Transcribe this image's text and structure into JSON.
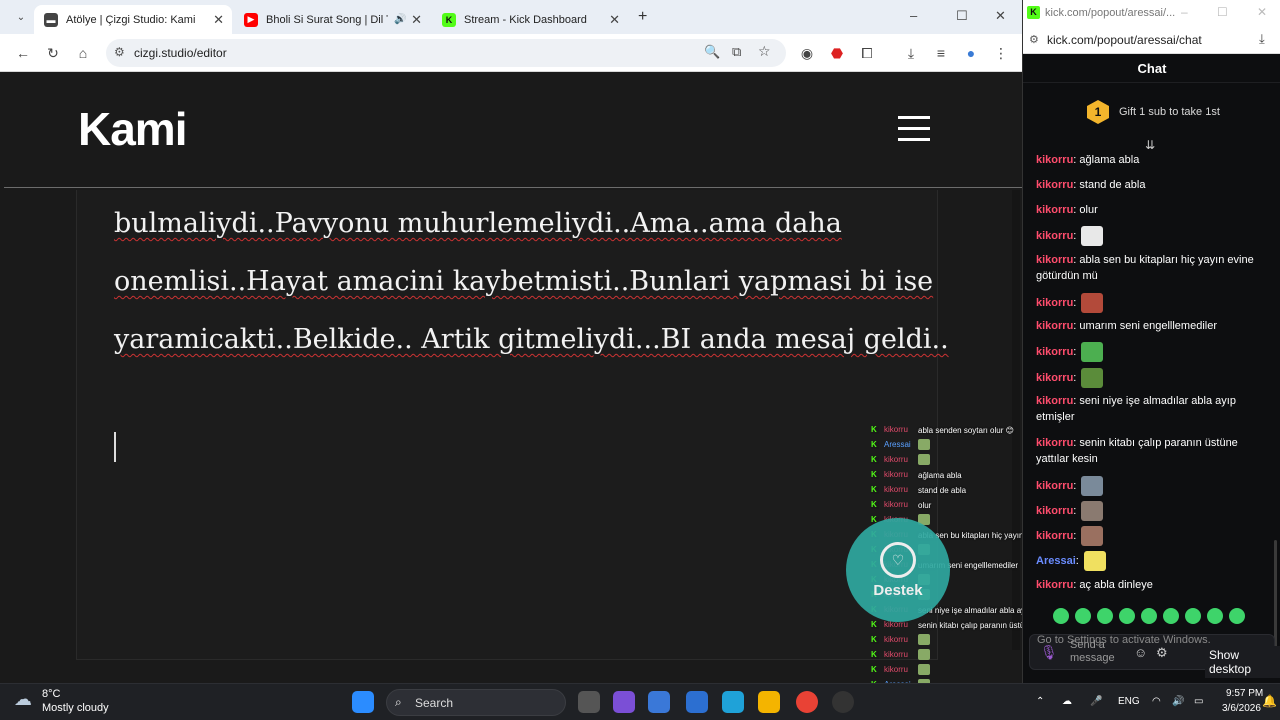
{
  "browser_left": {
    "tabs": [
      {
        "label": "Atölye | Çizgi Studio: Kami",
        "favicon": "cizgi-favicon",
        "active": true
      },
      {
        "label": "Bholi Si Surat Song | Dil To Pa",
        "favicon": "youtube-icon",
        "active": false
      },
      {
        "label": "Stream - Kick Dashboard",
        "favicon": "kick-icon",
        "active": false
      }
    ],
    "url": "cizgi.studio/editor",
    "new_tab": "+",
    "window_controls": {
      "minimize": "–",
      "maximize": "☐",
      "close": "✕"
    }
  },
  "site": {
    "brand": "Kami",
    "story_lines": [
      "bulmaliydi..Pavyonu muhurlemeliydi..Ama..ama daha",
      "onemlisi..Hayat amacini kaybetmisti..Bunlari yapmasi bi ise",
      "yaramicakti..Belkide.. Artik gitmeliydi...BI anda mesaj geldi.."
    ],
    "cursor_char": "'"
  },
  "overlay_chat": {
    "messages": [
      {
        "user": "kikorru",
        "text": "abla senden soytarı olur 😊"
      },
      {
        "user": "Aressai",
        "text": "",
        "emote": true,
        "blue": true
      },
      {
        "user": "kikorru",
        "text": "",
        "emote": true
      },
      {
        "user": "kikorru",
        "text": "ağlama abla"
      },
      {
        "user": "kikorru",
        "text": "stand de abla"
      },
      {
        "user": "kikorru",
        "text": "olur"
      },
      {
        "user": "kikorru",
        "text": "",
        "emote": true
      },
      {
        "user": "kikorru",
        "text": "abla sen bu kitapları hiç yayın evine götürdün mü"
      },
      {
        "user": "kikorru",
        "text": "",
        "emote": true
      },
      {
        "user": "kikorru",
        "text": "umarım seni engelllemediler"
      },
      {
        "user": "kikorru",
        "text": "",
        "emote": true
      },
      {
        "user": "kikorru",
        "text": "",
        "emote": true
      },
      {
        "user": "kikorru",
        "text": "seni niye işe almadılar abla ayıp etmişler"
      },
      {
        "user": "kikorru",
        "text": "senin kitabı çalıp paranın üstüne yattılar kesin"
      },
      {
        "user": "kikorru",
        "text": "",
        "emote": true
      },
      {
        "user": "kikorru",
        "text": "",
        "emote": true
      },
      {
        "user": "kikorru",
        "text": "",
        "emote": true
      },
      {
        "user": "Aressai",
        "text": "",
        "emote": true,
        "blue": true
      },
      {
        "user": "kikorru",
        "text": "aç abla dinleye"
      }
    ],
    "destek_label": "Destek"
  },
  "browser_right": {
    "title": "kick.com/popout/aressai/...",
    "url": "kick.com/popout/aressai/chat",
    "chat_title": "Chat",
    "gift_badge": "1",
    "gift_text": "Gift 1 sub to take 1st",
    "messages": [
      {
        "user": "kikorru",
        "text": "ağlama abla"
      },
      {
        "user": "kikorru",
        "text": "stand de abla"
      },
      {
        "user": "kikorru",
        "text": "olur"
      },
      {
        "user": "kikorru",
        "text": "",
        "emote_color": "#e8e8e8"
      },
      {
        "user": "kikorru",
        "text": "abla sen bu kitapları hiç yayın evine götürdün mü"
      },
      {
        "user": "kikorru",
        "text": "",
        "emote_color": "#b34a3a"
      },
      {
        "user": "kikorru",
        "text": "umarım seni engelllemediler"
      },
      {
        "user": "kikorru",
        "text": "",
        "emote_color": "#4caf50"
      },
      {
        "user": "kikorru",
        "text": "",
        "emote_color": "#5b8c3a"
      },
      {
        "user": "kikorru",
        "text": "seni niye işe almadılar abla ayıp etmişler"
      },
      {
        "user": "kikorru",
        "text": "senin kitabı çalıp paranın üstüne yattılar kesin"
      },
      {
        "user": "kikorru",
        "text": "",
        "emote_color": "#7a8a9a"
      },
      {
        "user": "kikorru",
        "text": "",
        "emote_color": "#8a7a70"
      },
      {
        "user": "kikorru",
        "text": "",
        "emote_color": "#9a7060"
      },
      {
        "user": "Aressai",
        "text": "",
        "emote_color": "#f0e060",
        "blue": true
      },
      {
        "user": "kikorru",
        "text": "aç abla dinleye"
      }
    ],
    "input_placeholder": "Send a message",
    "activate_windows": "Go to Settings to activate Windows.",
    "show_desktop": "Show desktop"
  },
  "taskbar": {
    "weather_temp": "8°C",
    "weather_desc": "Mostly cloudy",
    "search_label": "Search",
    "language": "ENG",
    "time": "9:57 PM",
    "date": "3/6/2026"
  },
  "colors": {
    "kick_green": "#53fc18",
    "chat_user": "#ff4d6d",
    "chat_user_blue": "#6a8cff",
    "destek": "#2fa8a0"
  }
}
